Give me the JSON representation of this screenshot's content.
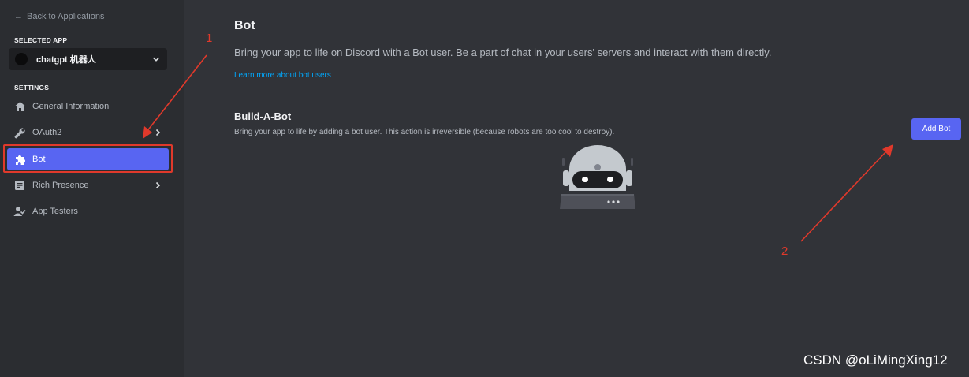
{
  "sidebar": {
    "back_label": "Back to Applications",
    "selected_app_heading": "SELECTED APP",
    "selected_app_name": "chatgpt 机器人",
    "settings_heading": "SETTINGS",
    "items": [
      {
        "label": "General Information",
        "icon": "home-icon",
        "has_chevron": false,
        "active": false
      },
      {
        "label": "OAuth2",
        "icon": "wrench-icon",
        "has_chevron": true,
        "active": false
      },
      {
        "label": "Bot",
        "icon": "puzzle-icon",
        "has_chevron": false,
        "active": true
      },
      {
        "label": "Rich Presence",
        "icon": "document-icon",
        "has_chevron": true,
        "active": false
      },
      {
        "label": "App Testers",
        "icon": "user-check-icon",
        "has_chevron": false,
        "active": false
      }
    ]
  },
  "main": {
    "title": "Bot",
    "description": "Bring your app to life on Discord with a Bot user. Be a part of chat in your users' servers and interact with them directly.",
    "learn_more": "Learn more about bot users",
    "build_title": "Build-A-Bot",
    "build_desc": "Bring your app to life by adding a bot user. This action is irreversible (because robots are too cool to destroy).",
    "add_bot_label": "Add Bot"
  },
  "annotations": {
    "label_1": "1",
    "label_2": "2",
    "color": "#e0392b"
  },
  "watermark": "CSDN @oLiMingXing12",
  "colors": {
    "accent": "#5865f2",
    "sidebar_bg": "#2b2d31",
    "main_bg": "#313338",
    "link": "#00a8fc"
  }
}
